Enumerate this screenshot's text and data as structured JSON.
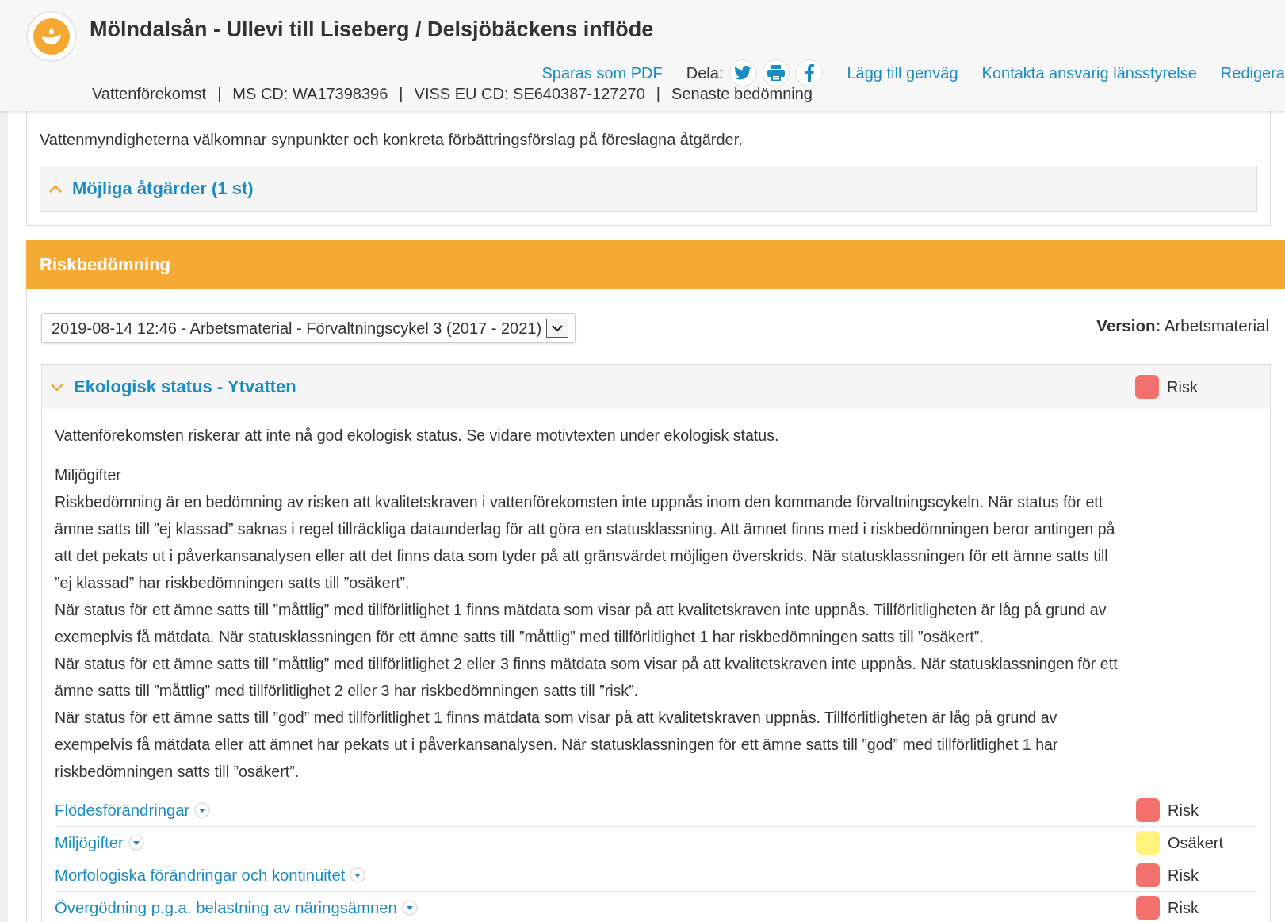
{
  "header": {
    "title": "Mölndalsån - Ullevi till Liseberg / Delsjöbäckens inflöde",
    "pdf_link": "Sparas som PDF",
    "share_label": "Dela:",
    "share_buttons": [
      {
        "kind": "twitter"
      },
      {
        "kind": "print"
      },
      {
        "kind": "facebook"
      }
    ],
    "links": [
      "Lägg till genväg",
      "Kontakta ansvarig länsstyrelse",
      "Redigera"
    ],
    "info": [
      "Vattenförekomst",
      "|",
      "MS  CD: WA17398396",
      "|",
      "VISS EU  CD: SE640387-127270",
      "|",
      "Senaste bedömning"
    ]
  },
  "intro_lines": [
    "Vattenmyndigheterna välkomnar synpunkter och konkreta förbättringsförslag på föreslagna åtgärder."
  ],
  "measures_panel": {
    "title": "Möjliga åtgärder (1 st)",
    "expanded": false
  },
  "risk_section": {
    "title": "Riskbedömning",
    "select": {
      "value": "2019-08-14 12:46 - Arbetsmaterial - Förvaltningscykel 3 (2017 - 2021)"
    },
    "version_label": "Version:",
    "version_value": "Arbetsmaterial",
    "panel": {
      "title": "Ekologisk status - Ytvatten",
      "expanded": true,
      "status": {
        "label": "Risk",
        "color": "#f2716c"
      },
      "summary": "Vattenförekomsten riskerar att inte nå god ekologisk status. Se vidare motivtexten under ekologisk status.",
      "subheading": "Miljögifter",
      "paragraphs": [
        "Riskbedömning är en bedömning av risken att kvalitetskraven i vattenförekomsten inte uppnås inom den kommande förvaltningscykeln. När status för ett ämne satts till ”ej klassad” saknas i regel tillräckliga dataunderlag för att göra en statusklassning. Att ämnet finns med i riskbedömningen beror antingen på att det pekats ut i påverkansanalysen eller att det finns data som tyder på att gränsvärdet möjligen överskrids. När statusklassningen för ett ämne satts till ”ej klassad” har riskbedömningen satts till ”osäkert”.",
        "När status för ett ämne satts till ”måttlig” med tillförlitlighet 1 finns mätdata som visar på att kvalitetskraven inte uppnås. Tillförlitligheten är låg på grund av exemeplvis få mätdata. När statusklassningen för ett ämne satts till ”måttlig” med tillförlitlighet 1 har riskbedömningen satts till ”osäkert”.",
        "När status för ett ämne satts till ”måttlig” med tillförlitlighet 2 eller 3 finns mätdata som visar på att kvalitetskraven inte uppnås. När statusklassningen för ett ämne satts till ”måttlig” med tillförlitlighet 2 eller 3 har riskbedömningen satts till ”risk”.",
        "När status för ett ämne satts till ”god” med tillförlitlighet 1 finns mätdata som visar på att kvalitetskraven uppnås. Tillförlitligheten är låg på grund av exempelvis få mätdata eller att ämnet har pekats ut i påverkansanalysen. När statusklassningen för ett ämne satts till ”god” med tillförlitlighet 1 har riskbedömningen satts till ”osäkert”."
      ],
      "factors": [
        {
          "name": "Flödesförändringar",
          "status": "Risk",
          "color": "#f2716c"
        },
        {
          "name": "Miljögifter",
          "status": "Osäkert",
          "color": "#fff37e"
        },
        {
          "name": "Morfologiska förändringar och kontinuitet",
          "status": "Risk",
          "color": "#f2716c"
        },
        {
          "name": "Övergödning p.g.a. belastning av näringsämnen",
          "status": "Risk",
          "color": "#f2716c"
        }
      ]
    }
  }
}
